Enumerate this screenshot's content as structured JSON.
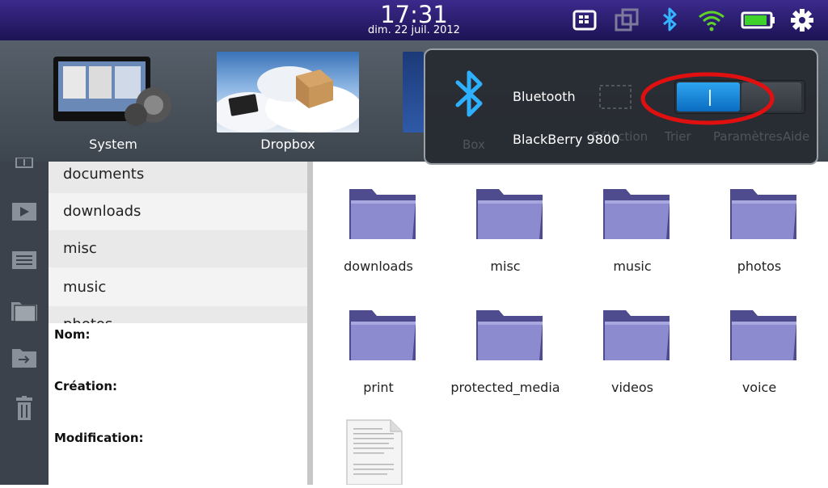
{
  "status_bar": {
    "time": "17:31",
    "date": "dim. 22 juil. 2012",
    "icons": [
      "bbm-icon",
      "multitask-icon",
      "bluetooth-icon",
      "wifi-icon",
      "battery-icon",
      "gear-icon"
    ],
    "battery_level": 0.9,
    "accent_color": "#3c2a8c"
  },
  "app_switcher": {
    "apps": [
      {
        "label": "System",
        "icon": "playbook-device-icon"
      },
      {
        "label": "Dropbox",
        "icon": "dropbox-icon"
      },
      {
        "label": "Box",
        "icon": "box-icon"
      }
    ]
  },
  "rail": {
    "icons": [
      "info-icon",
      "play-icon",
      "list-icon",
      "folders-icon",
      "move-icon",
      "trash-icon"
    ]
  },
  "folder_list": {
    "items": [
      "documents",
      "downloads",
      "misc",
      "music",
      "photos"
    ]
  },
  "properties": {
    "name_label": "Nom:",
    "created_label": "Création:",
    "modified_label": "Modification:"
  },
  "file_grid": {
    "folders": [
      "downloads",
      "misc",
      "music",
      "photos",
      "print",
      "protected_media",
      "videos",
      "voice"
    ],
    "folder_color": "#7a78c2",
    "extra_item_icon": "document-icon"
  },
  "bluetooth_popup": {
    "title": "Bluetooth",
    "device": "BlackBerry 9800",
    "toggle_on": true,
    "toggle_label": "I",
    "ghost_toolbar": [
      "Box",
      "Sélection",
      "Trier",
      "Paramètres",
      "Aide"
    ],
    "highlight_color": "#e01010"
  }
}
